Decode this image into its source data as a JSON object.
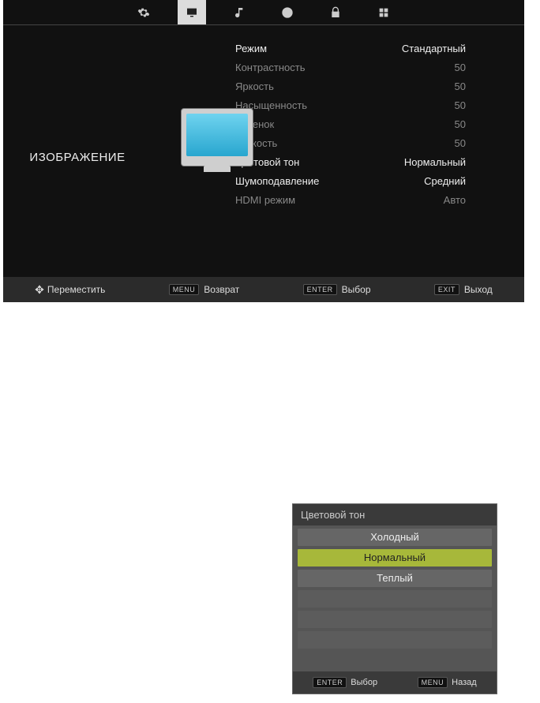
{
  "topMenu": {
    "tabs": [
      {
        "name": "settings-tab",
        "icon": "gear-icon"
      },
      {
        "name": "picture-tab",
        "icon": "monitor-icon",
        "active": true
      },
      {
        "name": "sound-tab",
        "icon": "note-icon"
      },
      {
        "name": "time-tab",
        "icon": "clock-icon"
      },
      {
        "name": "lock-tab",
        "icon": "lock-icon"
      },
      {
        "name": "apps-tab",
        "icon": "grid-icon"
      }
    ],
    "sectionTitle": "ИЗОБРАЖЕНИЕ",
    "settings": [
      {
        "label": "Режим",
        "value": "Стандартный",
        "enabled": true
      },
      {
        "label": "Контрастность",
        "value": "50",
        "enabled": false
      },
      {
        "label": "Яркость",
        "value": "50",
        "enabled": false
      },
      {
        "label": "Насыщенность",
        "value": "50",
        "enabled": false
      },
      {
        "label": "Оттенок",
        "value": "50",
        "enabled": false
      },
      {
        "label": "Резкость",
        "value": "50",
        "enabled": false
      },
      {
        "label": "Цветовой тон",
        "value": "Нормальный",
        "enabled": true
      },
      {
        "label": "Шумоподавление",
        "value": "Средний",
        "enabled": true
      },
      {
        "label": "HDMI режим",
        "value": "Авто",
        "enabled": false
      }
    ],
    "footer": {
      "move": {
        "key": "",
        "label": "Переместить"
      },
      "return": {
        "key": "MENU",
        "label": "Возврат"
      },
      "select": {
        "key": "ENTER",
        "label": "Выбор"
      },
      "exit": {
        "key": "EXIT",
        "label": "Выход"
      }
    }
  },
  "popup": {
    "title": "Цветовой тон",
    "options": [
      {
        "label": "Холодный",
        "selected": false
      },
      {
        "label": "Нормальный",
        "selected": true
      },
      {
        "label": "Теплый",
        "selected": false
      }
    ],
    "emptySlots": 3,
    "footer": {
      "select": {
        "key": "ENTER",
        "label": "Выбор"
      },
      "back": {
        "key": "MENU",
        "label": "Назад"
      }
    }
  }
}
